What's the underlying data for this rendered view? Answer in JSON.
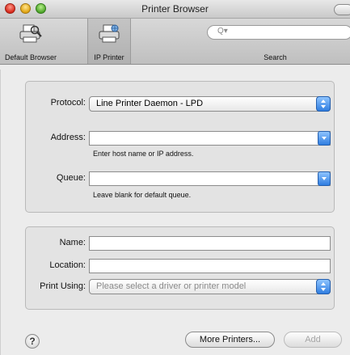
{
  "window": {
    "title": "Printer Browser"
  },
  "toolbar": {
    "default_browser_label": "Default Browser",
    "ip_printer_label": "IP Printer",
    "search_label": "Search",
    "search_placeholder": ""
  },
  "form": {
    "protocol_label": "Protocol:",
    "protocol_value": "Line Printer Daemon - LPD",
    "address_label": "Address:",
    "address_value": "",
    "address_hint": "Enter host name or IP address.",
    "queue_label": "Queue:",
    "queue_value": "",
    "queue_hint": "Leave blank for default queue.",
    "name_label": "Name:",
    "name_value": "",
    "location_label": "Location:",
    "location_value": "",
    "print_using_label": "Print Using:",
    "print_using_value": "Please select a driver or printer model"
  },
  "buttons": {
    "help": "?",
    "more_printers": "More Printers...",
    "add": "Add"
  },
  "colors": {
    "accent": "#2f7de0",
    "window_bg": "#ececec"
  }
}
